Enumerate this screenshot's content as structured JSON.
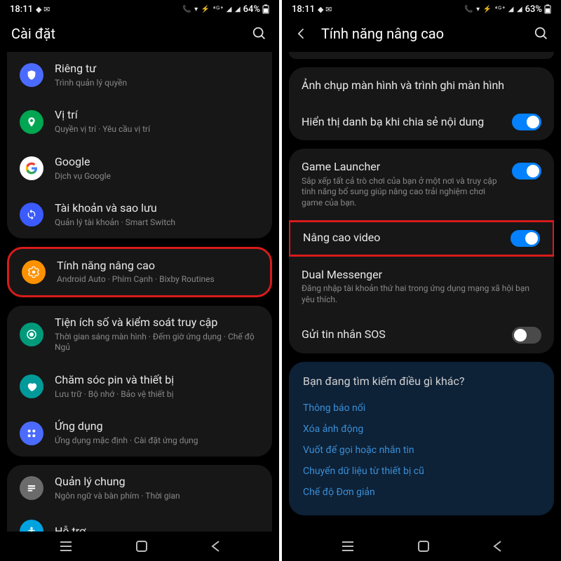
{
  "left": {
    "status": {
      "time": "18:11",
      "battery": "64%"
    },
    "header": {
      "title": "Cài đặt"
    },
    "items": [
      {
        "icon": "shield-icon",
        "color": "#4b6bff",
        "title": "Riêng tư",
        "sub": "Trình quản lý quyền"
      },
      {
        "icon": "pin-icon",
        "color": "#00a651",
        "title": "Vị trí",
        "sub": "Quyền vị trí · Yêu cầu vị trí"
      },
      {
        "icon": "google-icon",
        "color": "#ffffff",
        "title": "Google",
        "sub": "Dịch vụ Google"
      },
      {
        "icon": "sync-icon",
        "color": "#3b5bff",
        "title": "Tài khoản và sao lưu",
        "sub": "Quản lý tài khoản · Smart Switch"
      },
      {
        "icon": "gear-plus-icon",
        "color": "#ff9100",
        "title": "Tính năng nâng cao",
        "sub": "Android Auto · Phím Cạnh · Bixby Routines",
        "highlight": true
      },
      {
        "icon": "wellbeing-icon",
        "color": "#009a7b",
        "title": "Tiện ích số và kiểm soát truy cập",
        "sub": "Thời gian sáng màn hình · Đếm giờ ứng dụng · Chế độ Ngủ"
      },
      {
        "icon": "battery-icon",
        "color": "#009a9a",
        "title": "Chăm sóc pin và thiết bị",
        "sub": "Lưu trữ · Bộ nhớ · Bảo vệ thiết bị"
      },
      {
        "icon": "apps-icon",
        "color": "#4b6bff",
        "title": "Ứng dụng",
        "sub": "Ứng dụng mặc định · Cài đặt ứng dụng"
      },
      {
        "icon": "general-icon",
        "color": "#6b6b6b",
        "title": "Quản lý chung",
        "sub": "Ngôn ngữ và bàn phím · Thời gian"
      },
      {
        "icon": "accessibility-icon",
        "color": "#00a3e0",
        "title": "Hỗ trợ",
        "sub": ""
      }
    ]
  },
  "right": {
    "status": {
      "time": "18:11",
      "battery": "63%"
    },
    "header": {
      "title": "Tính năng nâng cao"
    },
    "group1": [
      {
        "title": "Ảnh chụp màn hình và trình ghi màn hình"
      },
      {
        "title": "Hiển thị danh bạ khi chia sẻ nội dung",
        "toggle": "on"
      }
    ],
    "group2": [
      {
        "title": "Game Launcher",
        "sub": "Sắp xếp tất cả trò chơi của bạn ở một nơi và truy cập tính năng bổ sung giúp nâng cao trải nghiệm chơi game của bạn.",
        "toggle": "on"
      },
      {
        "title": "Nâng cao video",
        "toggle": "on",
        "highlight": true
      },
      {
        "title": "Dual Messenger",
        "sub": "Đăng nhập tài khoản thứ hai trong ứng dụng mạng xã hội bạn yêu thích."
      },
      {
        "title": "Gửi tin nhắn SOS",
        "toggle": "off"
      }
    ],
    "suggest": {
      "title": "Bạn đang tìm kiếm điều gì khác?",
      "links": [
        "Thông báo nổi",
        "Xóa ảnh động",
        "Vuốt để gọi hoặc nhắn tin",
        "Chuyển dữ liệu từ thiết bị cũ",
        "Chế độ Đơn giản"
      ]
    }
  }
}
